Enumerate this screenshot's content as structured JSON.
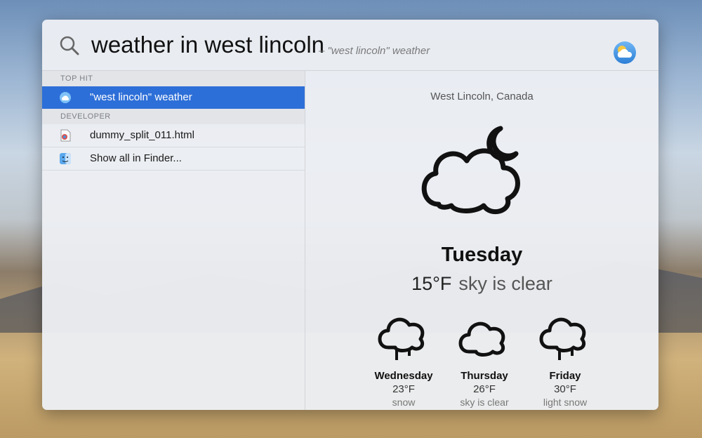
{
  "search": {
    "query": "weather in west lincoln",
    "hint": "– \"west lincoln\" weather"
  },
  "sections": [
    {
      "title": "TOP HIT",
      "items": [
        {
          "label": "\"west lincoln\" weather",
          "icon": "weather-icon",
          "selected": true
        }
      ]
    },
    {
      "title": "DEVELOPER",
      "items": [
        {
          "label": "dummy_split_011.html",
          "icon": "html-file-icon"
        }
      ]
    }
  ],
  "show_all": {
    "label": "Show all in Finder...",
    "icon": "finder-icon"
  },
  "weather": {
    "location": "West Lincoln, Canada",
    "today": {
      "day": "Tuesday",
      "temp": "15°F",
      "condition": "sky is clear"
    },
    "forecast": [
      {
        "day": "Wednesday",
        "temp": "23°F",
        "condition": "snow"
      },
      {
        "day": "Thursday",
        "temp": "26°F",
        "condition": "sky is clear"
      },
      {
        "day": "Friday",
        "temp": "30°F",
        "condition": "light snow"
      }
    ]
  },
  "colors": {
    "selection": "#2d6fd8",
    "panel": "#eceef2"
  }
}
